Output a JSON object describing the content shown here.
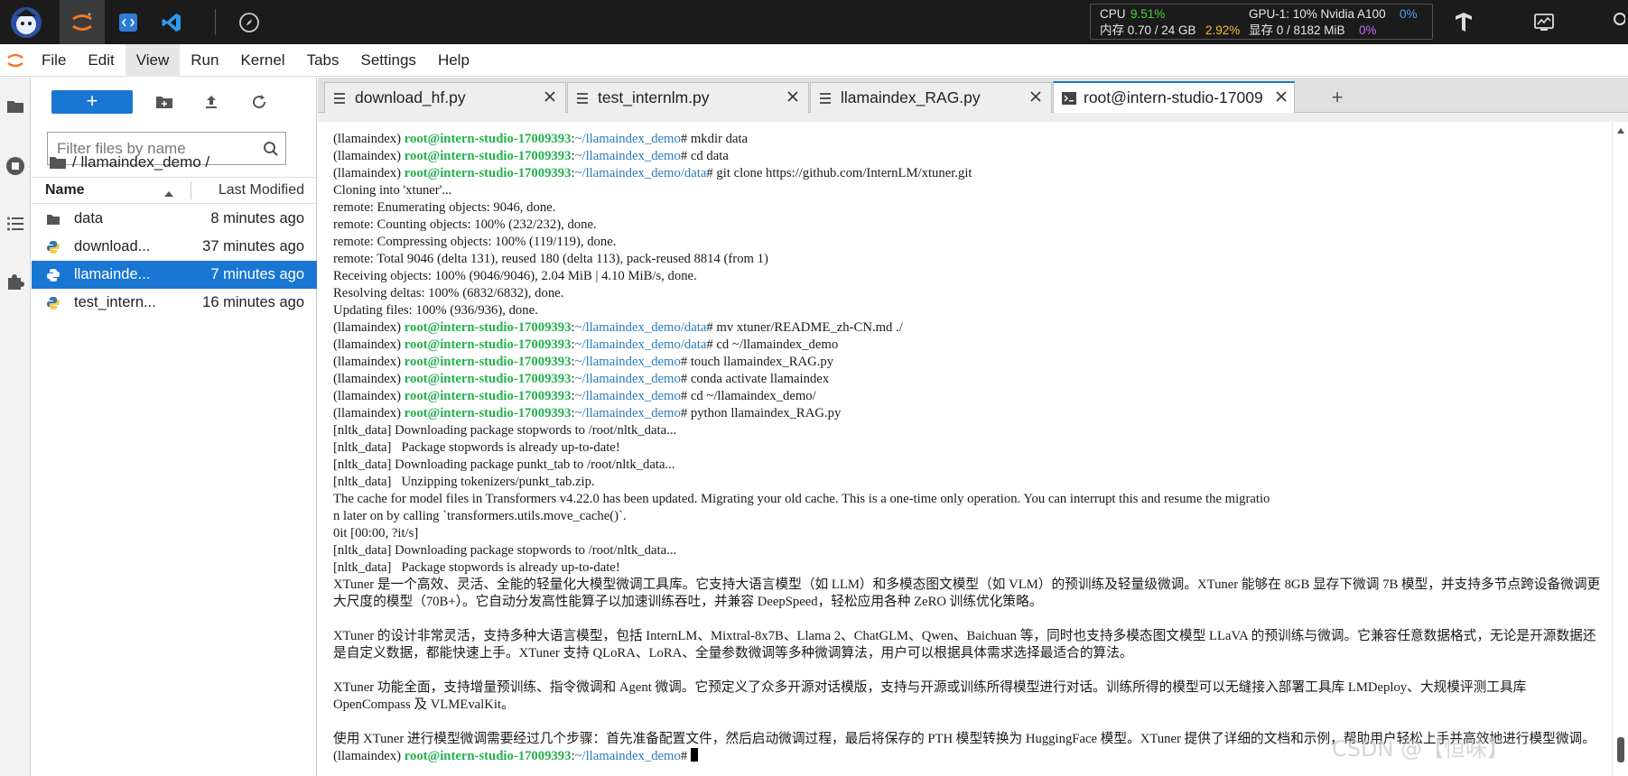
{
  "topbar": {
    "resources": {
      "cpu_label": "CPU",
      "cpu_value": "9.51%",
      "mem_label": "内存 0.70 / 24 GB",
      "mem_value": "2.92%",
      "gpu_label": "GPU-1: 10% Nvidia A100",
      "gpu_value": "0%",
      "vram_label": "显存 0 / 8182 MiB",
      "vram_value": "0%"
    },
    "icons": [
      "intern-logo-icon",
      "jupyter-icon",
      "code-icon",
      "vscode-icon",
      "compass-icon",
      "tensorflow-icon",
      "monitor-icon"
    ]
  },
  "menubar": {
    "items": [
      "File",
      "Edit",
      "View",
      "Run",
      "Kernel",
      "Tabs",
      "Settings",
      "Help"
    ],
    "active": "View"
  },
  "filebrowser": {
    "new_button": "+",
    "filter_placeholder": "Filter files by name",
    "breadcrumb": "/ llamaindex_demo /",
    "columns": {
      "name": "Name",
      "modified": "Last Modified"
    },
    "files": [
      {
        "name": "data",
        "type": "folder",
        "modified": "8 minutes ago",
        "selected": false
      },
      {
        "name": "download_hf.py",
        "display": "download...",
        "type": "python",
        "modified": "37 minutes ago",
        "selected": false
      },
      {
        "name": "llamaindex_RAG.py",
        "display": "llamainde...",
        "type": "python",
        "modified": "7 minutes ago",
        "selected": true
      },
      {
        "name": "test_internlm.py",
        "display": "test_intern...",
        "type": "python",
        "modified": "16 minutes ago",
        "selected": false
      }
    ]
  },
  "tabs": [
    {
      "label": "download_hf.py",
      "active": false
    },
    {
      "label": "test_internlm.py",
      "active": false
    },
    {
      "label": "llamaindex_RAG.py",
      "active": false
    },
    {
      "label": "root@intern-studio-17009",
      "active": true
    }
  ],
  "terminal": {
    "env": "(llamaindex)",
    "user": "root@intern-studio-17009393",
    "lines": [
      {
        "kind": "prompt",
        "path": "~/llamaindex_demo",
        "cmd": " mkdir data"
      },
      {
        "kind": "prompt",
        "path": "~/llamaindex_demo",
        "cmd": " cd data"
      },
      {
        "kind": "prompt",
        "path": "~/llamaindex_demo/data",
        "cmd": " git clone https://github.com/InternLM/xtuner.git"
      },
      {
        "kind": "text",
        "text": "Cloning into 'xtuner'..."
      },
      {
        "kind": "text",
        "text": "remote: Enumerating objects: 9046, done."
      },
      {
        "kind": "text",
        "text": "remote: Counting objects: 100% (232/232), done."
      },
      {
        "kind": "text",
        "text": "remote: Compressing objects: 100% (119/119), done."
      },
      {
        "kind": "text",
        "text": "remote: Total 9046 (delta 131), reused 180 (delta 113), pack-reused 8814 (from 1)"
      },
      {
        "kind": "text",
        "text": "Receiving objects: 100% (9046/9046), 2.04 MiB | 4.10 MiB/s, done."
      },
      {
        "kind": "text",
        "text": "Resolving deltas: 100% (6832/6832), done."
      },
      {
        "kind": "text",
        "text": "Updating files: 100% (936/936), done."
      },
      {
        "kind": "prompt",
        "path": "~/llamaindex_demo/data",
        "cmd": " mv xtuner/README_zh-CN.md ./"
      },
      {
        "kind": "prompt",
        "path": "~/llamaindex_demo/data",
        "cmd": " cd ~/llamaindex_demo"
      },
      {
        "kind": "prompt",
        "path": "~/llamaindex_demo",
        "cmd": " touch llamaindex_RAG.py"
      },
      {
        "kind": "prompt",
        "path": "~/llamaindex_demo",
        "cmd": " conda activate llamaindex"
      },
      {
        "kind": "prompt",
        "path": "~/llamaindex_demo",
        "cmd": " cd ~/llamaindex_demo/"
      },
      {
        "kind": "prompt",
        "path": "~/llamaindex_demo",
        "cmd": " python llamaindex_RAG.py"
      },
      {
        "kind": "text",
        "text": "[nltk_data] Downloading package stopwords to /root/nltk_data..."
      },
      {
        "kind": "text",
        "text": "[nltk_data]   Package stopwords is already up-to-date!"
      },
      {
        "kind": "text",
        "text": "[nltk_data] Downloading package punkt_tab to /root/nltk_data..."
      },
      {
        "kind": "text",
        "text": "[nltk_data]   Unzipping tokenizers/punkt_tab.zip."
      },
      {
        "kind": "text",
        "text": "The cache for model files in Transformers v4.22.0 has been updated. Migrating your old cache. This is a one-time only operation. You can interrupt this and resume the migratio"
      },
      {
        "kind": "text",
        "text": "n later on by calling `transformers.utils.move_cache()`."
      },
      {
        "kind": "text",
        "text": "0it [00:00, ?it/s]"
      },
      {
        "kind": "text",
        "text": "[nltk_data] Downloading package stopwords to /root/nltk_data..."
      },
      {
        "kind": "text",
        "text": "[nltk_data]   Package stopwords is already up-to-date!"
      },
      {
        "kind": "wrap",
        "text": "XTuner 是一个高效、灵活、全能的轻量化大模型微调工具库。它支持大语言模型（如 LLM）和多模态图文模型（如 VLM）的预训练及轻量级微调。XTuner 能够在 8GB 显存下微调 7B 模型，并支持多节点跨设备微调更大尺度的模型（70B+）。它自动分发高性能算子以加速训练吞吐，并兼容 DeepSpeed，轻松应用各种 ZeRO 训练优化策略。"
      },
      {
        "kind": "text",
        "text": ""
      },
      {
        "kind": "wrap",
        "text": "XTuner 的设计非常灵活，支持多种大语言模型，包括 InternLM、Mixtral-8x7B、Llama 2、ChatGLM、Qwen、Baichuan 等，同时也支持多模态图文模型 LLaVA 的预训练与微调。它兼容任意数据格式，无论是开源数据还是自定义数据，都能快速上手。XTuner 支持 QLoRA、LoRA、全量参数微调等多种微调算法，用户可以根据具体需求选择最适合的算法。"
      },
      {
        "kind": "text",
        "text": ""
      },
      {
        "kind": "wrap",
        "text": "XTuner 功能全面，支持增量预训练、指令微调和 Agent 微调。它预定义了众多开源对话模版，支持与开源或训练所得模型进行对话。训练所得的模型可以无缝接入部署工具库 LMDeploy、大规模评测工具库 OpenCompass 及 VLMEvalKit。"
      },
      {
        "kind": "text",
        "text": ""
      },
      {
        "kind": "wrap",
        "text": "使用 XTuner 进行模型微调需要经过几个步骤：首先准备配置文件，然后启动微调过程，最后将保存的 PTH 模型转换为 HuggingFace 模型。XTuner 提供了详细的文档和示例，帮助用户轻松上手并高效地进行模型微调。"
      },
      {
        "kind": "prompt_cursor",
        "path": "~/llamaindex_demo",
        "cmd": " "
      }
    ]
  },
  "watermark": "CSDN @【恒味】"
}
